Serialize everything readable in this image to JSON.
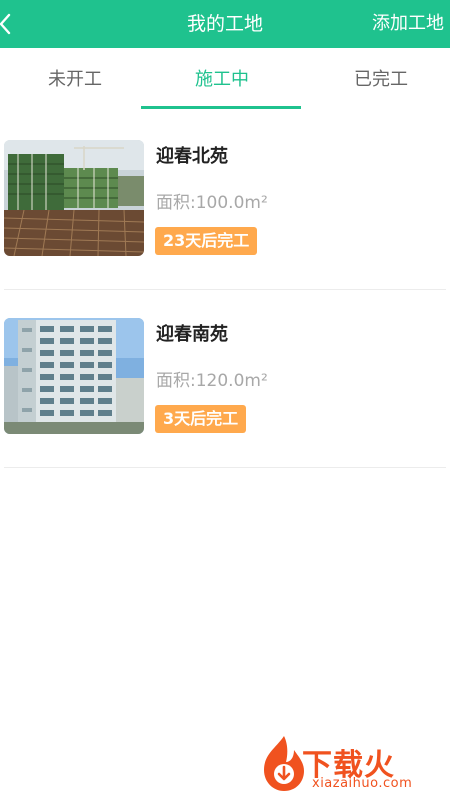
{
  "header": {
    "title": "我的工地",
    "action_label": "添加工地",
    "back_icon": "chevron-left-icon"
  },
  "tabs": [
    {
      "label": "未开工",
      "active": false
    },
    {
      "label": "施工中",
      "active": true
    },
    {
      "label": "已完工",
      "active": false
    }
  ],
  "sites": [
    {
      "name": "迎春北苑",
      "area_label": "面积:100.0",
      "area_unit": "m²",
      "badge": "23天后完工"
    },
    {
      "name": "迎春南苑",
      "area_label": "面积:120.0",
      "area_unit": "m²",
      "badge": "3天后完工"
    }
  ],
  "watermark": {
    "text": "下载火",
    "subtext": "xiazaihuo.com"
  },
  "colors": {
    "accent": "#1fc28e",
    "badge": "#ffa94d",
    "watermark": "#f0521f"
  }
}
